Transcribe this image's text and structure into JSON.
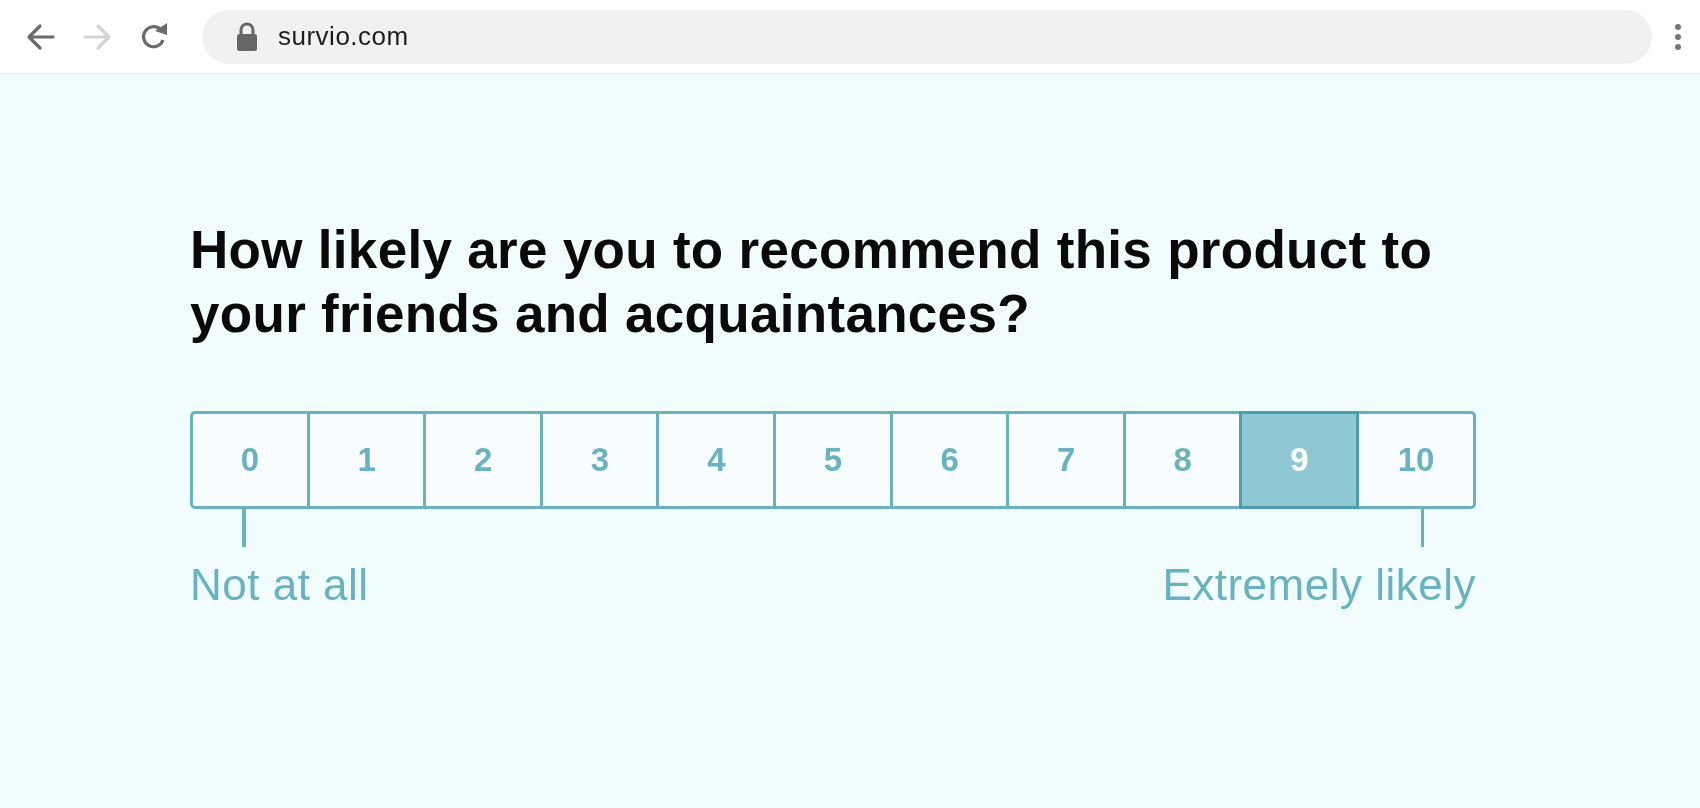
{
  "browser": {
    "url": "survio.com",
    "back_enabled": true,
    "forward_enabled": false
  },
  "question": "How likely are you to recommend this product to your friends and acquaintances?",
  "scale": {
    "options": [
      {
        "label": "0",
        "selected": false
      },
      {
        "label": "1",
        "selected": false
      },
      {
        "label": "2",
        "selected": false
      },
      {
        "label": "3",
        "selected": false
      },
      {
        "label": "4",
        "selected": false
      },
      {
        "label": "5",
        "selected": false
      },
      {
        "label": "6",
        "selected": false
      },
      {
        "label": "7",
        "selected": false
      },
      {
        "label": "8",
        "selected": false
      },
      {
        "label": "9",
        "selected": true
      },
      {
        "label": "10",
        "selected": false
      }
    ],
    "min_label": "Not at all",
    "max_label": "Extremely likely"
  }
}
